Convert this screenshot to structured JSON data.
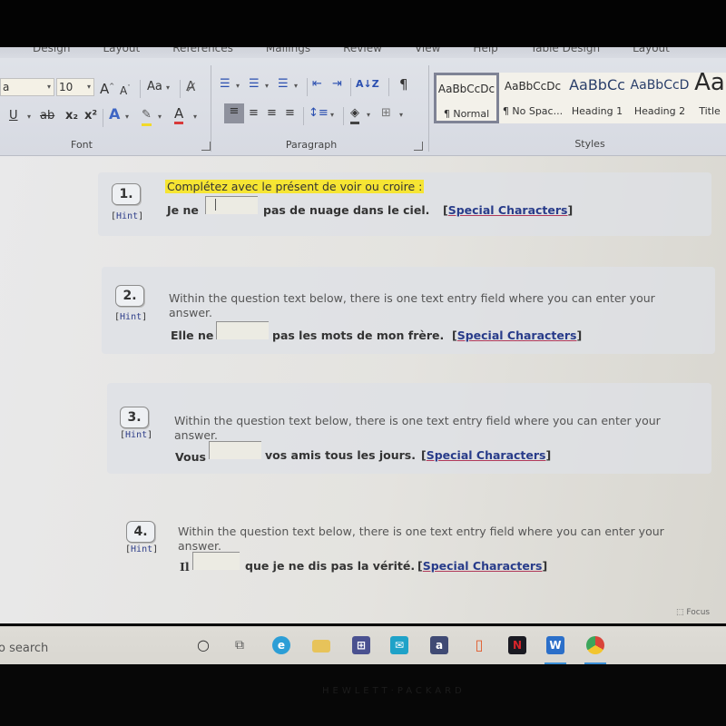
{
  "ribbon": {
    "tabs": [
      "Design",
      "Layout",
      "References",
      "Mailings",
      "Review",
      "View",
      "Help",
      "Table Design",
      "Layout"
    ],
    "font": {
      "font_name_partial": "a",
      "font_size": "10",
      "grow_font": "A",
      "shrink_font": "A",
      "change_case": "Aa",
      "underline": "U",
      "strikethrough": "ab",
      "subscript": "x₂",
      "superscript": "x²",
      "text_effects": "A",
      "font_color": "A",
      "label": "Font"
    },
    "paragraph": {
      "sort": "A↓Z",
      "show_marks": "¶",
      "label": "Paragraph"
    },
    "styles": {
      "items": [
        {
          "preview": "AaBbCcDc",
          "name": "¶ Normal",
          "selected": true
        },
        {
          "preview": "AaBbCcDc",
          "name": "¶ No Spac...",
          "selected": false
        },
        {
          "preview": "AaBbCc",
          "name": "Heading 1",
          "selected": false
        },
        {
          "preview": "AaBbCcD",
          "name": "Heading 2",
          "selected": false
        },
        {
          "preview": "Aa",
          "name": "Title",
          "selected": false
        }
      ],
      "label": "Styles"
    }
  },
  "questions": [
    {
      "number": "1.",
      "hint": "Hint",
      "prompt": "Complétez avec le présent de voir ou croire :",
      "prompt_highlighted": true,
      "before": "Je ne",
      "answer": "",
      "after": "pas de nuage dans le ciel.",
      "special_link": "Special Characters"
    },
    {
      "number": "2.",
      "hint": "Hint",
      "prompt_line1": "Within the question text below, there is one text entry field where you can enter your",
      "prompt_line2": "answer.",
      "before": "Elle ne",
      "answer": "",
      "after": "pas les mots de mon frère.",
      "special_link": "Special Characters"
    },
    {
      "number": "3.",
      "hint": "Hint",
      "prompt_line1": "Within the question text below, there is one text entry field where you can enter your",
      "prompt_line2": "answer.",
      "before": "Vous",
      "answer": "",
      "after": "vos amis tous les jours.",
      "special_link": "Special Characters"
    },
    {
      "number": "4.",
      "hint": "Hint",
      "prompt_line1": "Within the question text below, there is one text entry field where you can enter your",
      "prompt_line2": "answer.",
      "before": "Il",
      "answer": "",
      "after": "que je ne dis pas la vérité.",
      "special_link": "Special Characters"
    }
  ],
  "status": {
    "focus_label": "Focus"
  },
  "taskbar": {
    "search_partial": "o search",
    "icons": [
      "cortana-icon",
      "task-view-icon",
      "edge-icon",
      "file-explorer-icon",
      "store-icon",
      "mail-icon",
      "amazon-icon",
      "office-icon",
      "netflix-icon",
      "word-icon",
      "chrome-icon"
    ],
    "amazon_glyph": "a",
    "netflix_glyph": "N",
    "word_glyph": "W"
  },
  "device": {
    "brand": "HEWLETT·PACKARD"
  }
}
